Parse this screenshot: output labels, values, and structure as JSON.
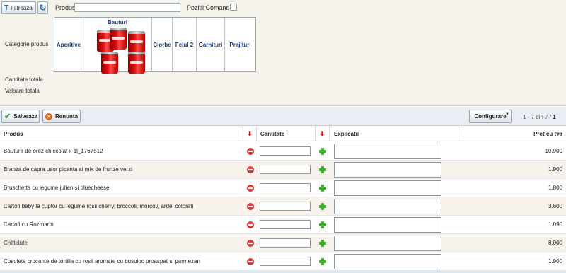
{
  "filter": {
    "filter_button_label": "Filtrează",
    "refresh_icon": "refresh-icon",
    "produs_label": "Produs",
    "produs_value": "",
    "pozitii_label": "Pozitii Comanda",
    "pozitii_checked": false
  },
  "categories": {
    "label": "Categorie produs",
    "items": [
      {
        "label": "Aperitive"
      },
      {
        "label": "Bauturi",
        "image": "coca-cola-cans"
      },
      {
        "label": "Ciorbe"
      },
      {
        "label": "Felul 2"
      },
      {
        "label": "Garnituri"
      },
      {
        "label": "Prajituri"
      }
    ]
  },
  "totals": {
    "cantitate_label": "Cantitate totala",
    "valoare_label": "Valoare totala"
  },
  "toolbar": {
    "save_label": "Salveaza",
    "cancel_label": "Renunta",
    "config_label": "Configurare",
    "pager_range": "1 - 7 din 7 /",
    "pager_page": "1"
  },
  "table": {
    "headers": {
      "produs": "Produs",
      "cantitate": "Cantitate",
      "explicatii": "Explicatii",
      "pret": "Pret cu tva"
    },
    "rows": [
      {
        "produs": "Bautura de orez chiccolat x 1l_1767512",
        "pret": "10.900"
      },
      {
        "produs": "Branza de capra usor picanta si mix de frunze verzi",
        "pret": "1.900"
      },
      {
        "produs": "Bruschetta cu legume julien si bluecheese",
        "pret": "1.800"
      },
      {
        "produs": "Cartofi baby la cuptor cu legume rosii cherry, broccoli, morcov, ardei colorati",
        "pret": "3.600"
      },
      {
        "produs": "Cartofi cu Rozmarin",
        "pret": "1.090"
      },
      {
        "produs": "Chiftelute",
        "pret": "8.000"
      },
      {
        "produs": "Cosulete crocante de tortilla cu rosii aromate cu busuioc proaspat si parmezan",
        "pret": "1.900"
      }
    ]
  }
}
